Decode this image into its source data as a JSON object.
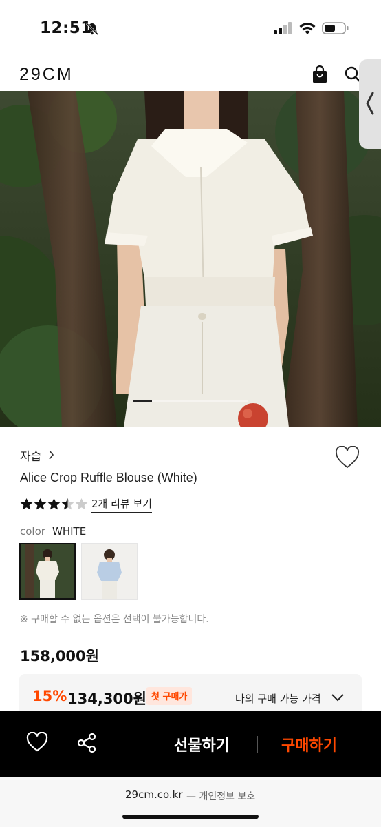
{
  "status_bar": {
    "time": "12:51",
    "icons": [
      "bell-slash-icon",
      "signal-icon",
      "wifi-icon",
      "battery-icon"
    ]
  },
  "header": {
    "logo": "29CM",
    "icons": [
      "shopping-bag-icon",
      "search-icon"
    ]
  },
  "carousel": {
    "current_slide_fraction": 0.17
  },
  "product": {
    "brand": "자습",
    "name": "Alice Crop Ruffle Blouse (White)",
    "rating": 3.5,
    "review_link": "2개 리뷰 보기",
    "color_label": "color",
    "color_value": "WHITE",
    "notice": "※ 구매할 수 없는 옵션은 선택이 불가능합니다.",
    "price": "158,000원",
    "discount_percent": "15%",
    "discount_price": "134,300원",
    "first_purchase_badge": "첫 구매가",
    "my_price_label": "나의 구매 가능 가격"
  },
  "bottom_bar": {
    "gift_label": "선물하기",
    "buy_label": "구매하기"
  },
  "browser": {
    "domain": "29cm.co.kr",
    "note": "— 개인정보 보호"
  },
  "colors": {
    "accent": "#ff4800",
    "bar": "#000000"
  }
}
